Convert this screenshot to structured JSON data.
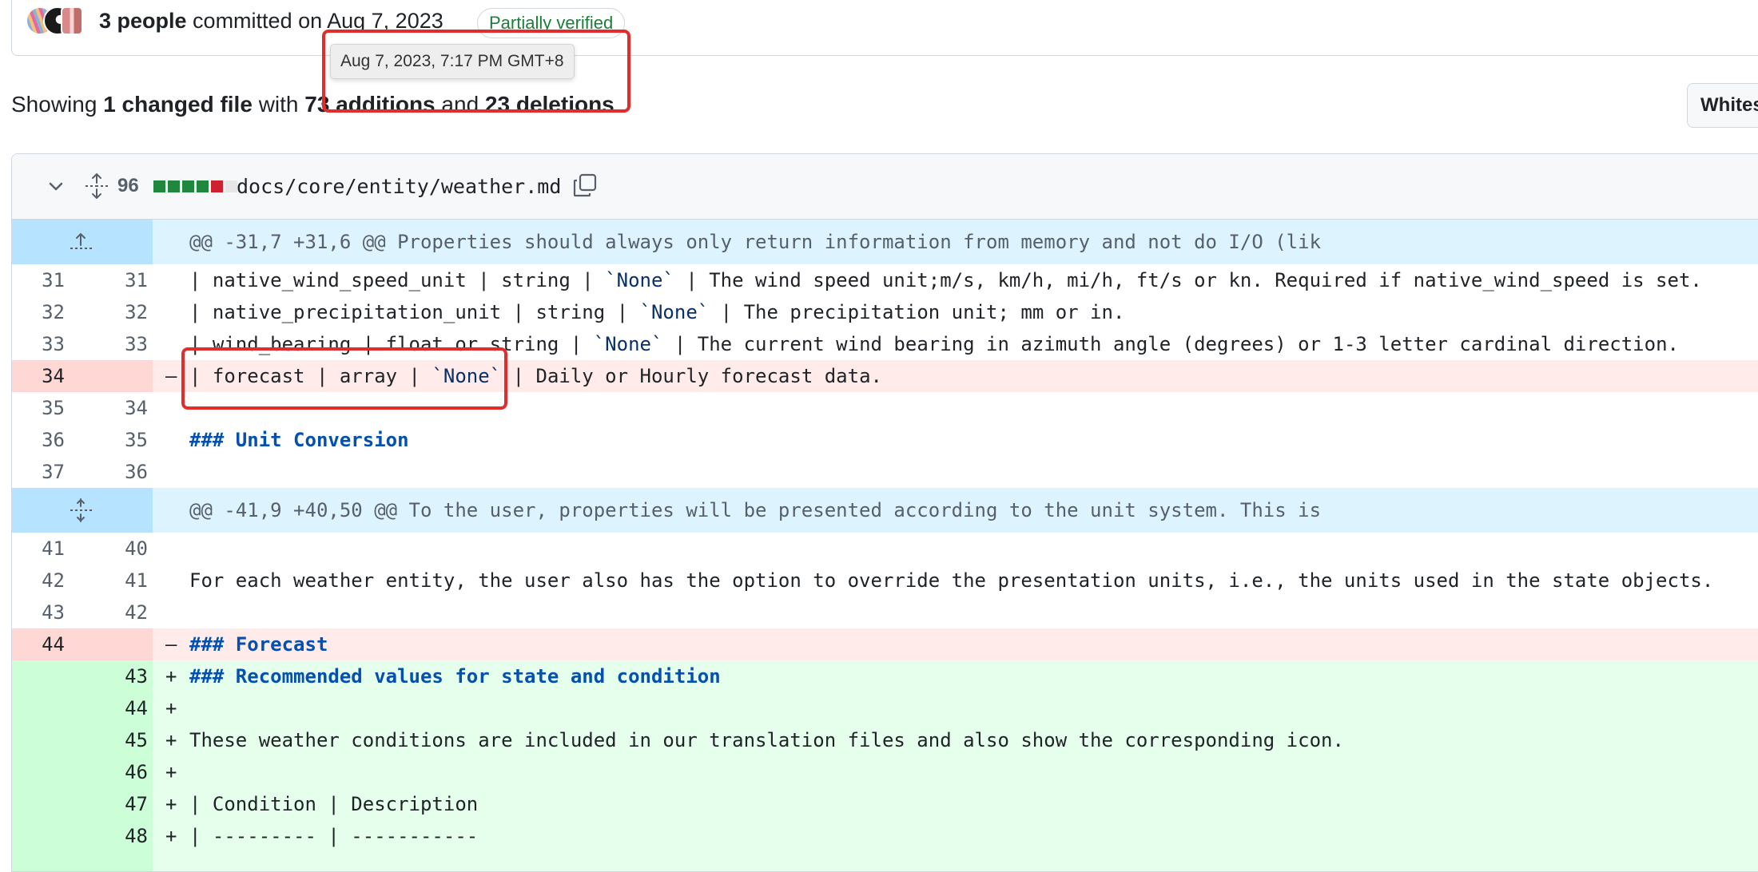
{
  "commit": {
    "people": "3 people",
    "committed_on": "committed on Aug 7, 2023",
    "verification_badge": "Partially verified",
    "tooltip": "Aug 7, 2023, 7:17 PM GMT+8"
  },
  "summary": {
    "prefix": "Showing",
    "changed": "1 changed file",
    "with": "with",
    "additions": "73 additions",
    "and": "and",
    "deletions": "23 deletions",
    "suffix": "."
  },
  "whitespace_button": "Whites",
  "file": {
    "change_count": "96",
    "path": "docs/core/entity/weather.md",
    "diffstat": [
      "add",
      "add",
      "add",
      "add",
      "del",
      "neutral"
    ]
  },
  "hunk1": "@@ -31,7 +31,6 @@ Properties should always only return information from memory and not do I/O (lik",
  "hunk2": "@@ -41,9 +40,50 @@ To the user, properties will be presented according to the unit system. This is",
  "lines": {
    "l1": {
      "old": "31",
      "new": "31",
      "sign": "",
      "a": "| native_wind_speed_unit | string | ",
      "t": "`None`",
      "b": " | The wind speed unit;m/s, km/h, mi/h, ft/s or kn. Required if native_wind_speed is set."
    },
    "l2": {
      "old": "32",
      "new": "32",
      "sign": "",
      "a": "| native_precipitation_unit | string | ",
      "t": "`None`",
      "b": " | The precipitation unit; mm or in."
    },
    "l3": {
      "old": "33",
      "new": "33",
      "sign": "",
      "a": "| wind_bearing | float or string | ",
      "t": "`None`",
      "b": " | The current wind bearing in azimuth angle (degrees) or 1-3 letter cardinal direction."
    },
    "l4": {
      "old": "34",
      "new": "",
      "sign": "–",
      "a": "| forecast | array | ",
      "t": "`None`",
      "b": " | Daily or Hourly forecast data."
    },
    "l5": {
      "old": "35",
      "new": "34",
      "sign": "",
      "text": ""
    },
    "l6": {
      "old": "36",
      "new": "35",
      "sign": "",
      "text": "### Unit Conversion"
    },
    "l7": {
      "old": "37",
      "new": "36",
      "sign": "",
      "text": ""
    },
    "l8": {
      "old": "41",
      "new": "40",
      "sign": "",
      "text": ""
    },
    "l9": {
      "old": "42",
      "new": "41",
      "sign": "",
      "text": "For each weather entity, the user also has the option to override the presentation units, i.e., the units used in the state objects."
    },
    "l10": {
      "old": "43",
      "new": "42",
      "sign": "",
      "text": ""
    },
    "l11": {
      "old": "44",
      "new": "",
      "sign": "–",
      "text": "### Forecast"
    },
    "l12": {
      "old": "",
      "new": "43",
      "sign": "+",
      "text": "### Recommended values for state and condition"
    },
    "l13": {
      "old": "",
      "new": "44",
      "sign": "+",
      "text": ""
    },
    "l14": {
      "old": "",
      "new": "45",
      "sign": "+",
      "text": "These weather conditions are included in our translation files and also show the corresponding icon."
    },
    "l15": {
      "old": "",
      "new": "46",
      "sign": "+",
      "text": ""
    },
    "l16": {
      "old": "",
      "new": "47",
      "sign": "+",
      "text": "| Condition | Description"
    },
    "l17": {
      "old": "",
      "new": "48",
      "sign": "+",
      "text": "| --------- | -----------"
    }
  },
  "colors": {
    "added": "#e6ffec",
    "deleted": "#ffebe9",
    "hunk": "#ddf4ff",
    "annotation": "#e22d2d"
  }
}
